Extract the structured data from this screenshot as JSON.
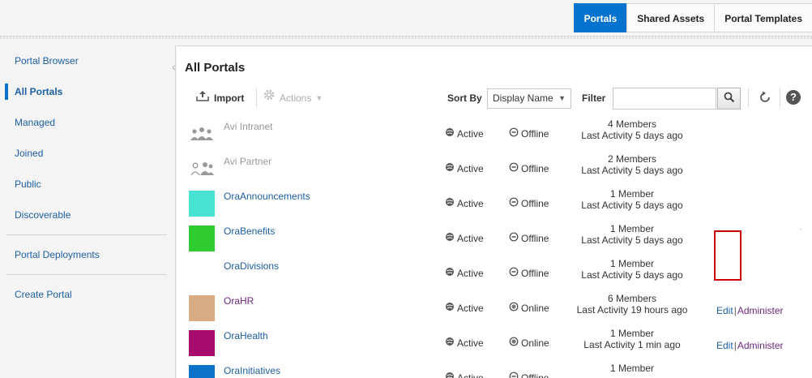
{
  "tabs": [
    {
      "label": "Portals",
      "active": true
    },
    {
      "label": "Shared Assets",
      "active": false
    },
    {
      "label": "Portal Templates",
      "active": false
    }
  ],
  "sidebar": {
    "items": [
      {
        "label": "Portal Browser"
      },
      {
        "label": "All Portals",
        "selected": true
      },
      {
        "label": "Managed"
      },
      {
        "label": "Joined"
      },
      {
        "label": "Public"
      },
      {
        "label": "Discoverable"
      },
      {
        "label": "Portal Deployments"
      },
      {
        "label": "Create Portal"
      }
    ]
  },
  "main": {
    "title": "All Portals",
    "toolbar": {
      "import_label": "Import",
      "actions_label": "Actions",
      "sort_label": "Sort By",
      "sort_value": "Display Name",
      "filter_label": "Filter",
      "filter_value": ""
    },
    "portals": [
      {
        "name": "Avi Intranet",
        "thumb": "people",
        "thumb_color": "",
        "name_style": "gray",
        "status": "Active",
        "state": "Offline",
        "members": "4 Members",
        "activity": "Last Activity 5 days ago",
        "actions": false
      },
      {
        "name": "Avi Partner",
        "thumb": "people-alt",
        "thumb_color": "",
        "name_style": "gray",
        "status": "Active",
        "state": "Offline",
        "members": "2 Members",
        "activity": "Last Activity 5 days ago",
        "actions": false
      },
      {
        "name": "OraAnnouncements",
        "thumb": "color",
        "thumb_color": "#48e3d4",
        "name_style": "blue",
        "status": "Active",
        "state": "Offline",
        "members": "1 Member",
        "activity": "Last Activity 5 days ago",
        "actions": false
      },
      {
        "name": "OraBenefits",
        "thumb": "color",
        "thumb_color": "#2ecc2e",
        "name_style": "blue",
        "status": "Active",
        "state": "Offline",
        "members": "1 Member",
        "activity": "Last Activity 5 days ago",
        "actions": false
      },
      {
        "name": "OraDivisions",
        "thumb": "none",
        "thumb_color": "",
        "name_style": "blue",
        "status": "Active",
        "state": "Offline",
        "members": "1 Member",
        "activity": "Last Activity 5 days ago",
        "actions": false
      },
      {
        "name": "OraHR",
        "thumb": "color",
        "thumb_color": "#d8ac84",
        "name_style": "purple",
        "status": "Active",
        "state": "Online",
        "members": "6 Members",
        "activity": "Last Activity 19 hours ago",
        "actions": true,
        "edit_label": "Edit",
        "administer_label": "Administer"
      },
      {
        "name": "OraHealth",
        "thumb": "color",
        "thumb_color": "#a80b6e",
        "name_style": "blue",
        "status": "Active",
        "state": "Online",
        "members": "1 Member",
        "activity": "Last Activity 1 min ago",
        "actions": true,
        "edit_label": "Edit",
        "administer_label": "Administer"
      },
      {
        "name": "OraInitiatives",
        "thumb": "color",
        "thumb_color": "#0b72c9",
        "name_style": "blue",
        "status": "Active",
        "state": "Offline",
        "members": "1 Member",
        "activity": "",
        "actions": false
      }
    ]
  },
  "icons": {
    "import": "upload-icon",
    "actions": "gear-icon",
    "search": "magnifier-icon",
    "refresh": "refresh-icon",
    "help": "help-icon",
    "active": "globe-icon",
    "offline": "minus-circle-icon",
    "online": "radio-dot-icon"
  },
  "colors": {
    "accent": "#0572ce",
    "link": "#1d5fa1",
    "visited_link": "#6f2a7f",
    "highlight": "#cc0000"
  }
}
